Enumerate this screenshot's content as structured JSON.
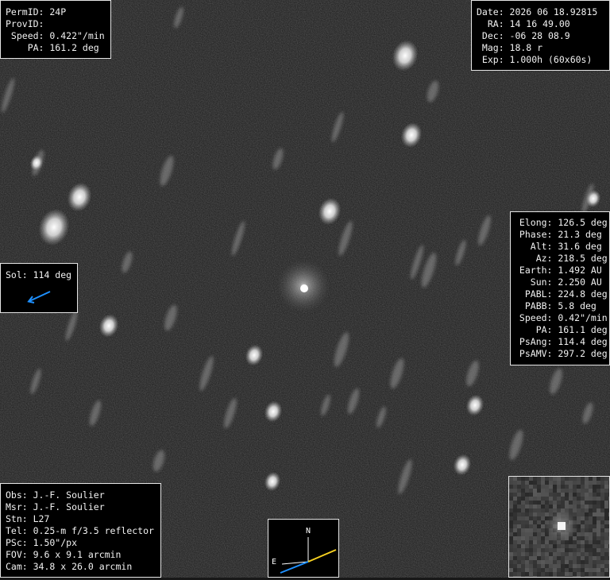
{
  "top_left": [
    {
      "key": "PermID:",
      "value": "24P"
    },
    {
      "key": "ProvID:",
      "value": ""
    },
    {
      "key": " Speed:",
      "value": "0.422\"/min"
    },
    {
      "key": "    PA:",
      "value": "161.2 deg"
    }
  ],
  "top_right": [
    {
      "key": "Date:",
      "value": "2026 06 18.92815"
    },
    {
      "key": "  RA:",
      "value": "14 16 49.00"
    },
    {
      "key": " Dec:",
      "value": "-06 28 08.9"
    },
    {
      "key": " Mag:",
      "value": "18.8 r"
    },
    {
      "key": " Exp:",
      "value": "1.000h (60x60s)"
    }
  ],
  "ephemeris": [
    {
      "key": " Elong:",
      "value": "126.5 deg"
    },
    {
      "key": " Phase:",
      "value": "21.3 deg"
    },
    {
      "key": "   Alt:",
      "value": "31.6 deg"
    },
    {
      "key": "    Az:",
      "value": "218.5 deg"
    },
    {
      "key": " Earth:",
      "value": "1.492 AU"
    },
    {
      "key": "   Sun:",
      "value": "2.250 AU"
    },
    {
      "key": "  PABL:",
      "value": "224.8 deg"
    },
    {
      "key": "  PABB:",
      "value": "5.8 deg"
    },
    {
      "key": " Speed:",
      "value": "0.42\"/min"
    },
    {
      "key": "    PA:",
      "value": "161.1 deg"
    },
    {
      "key": " PsAng:",
      "value": "114.4 deg"
    },
    {
      "key": " PsAMV:",
      "value": "297.2 deg"
    }
  ],
  "sol": {
    "key": "Sol:",
    "value": "114 deg",
    "arrow_color": "#1e90ff"
  },
  "observer": [
    {
      "key": "Obs:",
      "value": "J.-F. Soulier"
    },
    {
      "key": "Msr:",
      "value": "J.-F. Soulier"
    },
    {
      "key": "Stn:",
      "value": "L27"
    },
    {
      "key": "Tel:",
      "value": "0.25-m f/3.5 reflector"
    },
    {
      "key": "PSc:",
      "value": "1.50\"/px"
    },
    {
      "key": "FOV:",
      "value": "9.6 x 9.1 arcmin"
    },
    {
      "key": "Cam:",
      "value": "34.8 x 26.0 arcmin"
    }
  ],
  "compass": {
    "north_label": "N",
    "east_label": "E",
    "motion_color": "#f5d020",
    "sun_color": "#1e90ff"
  }
}
